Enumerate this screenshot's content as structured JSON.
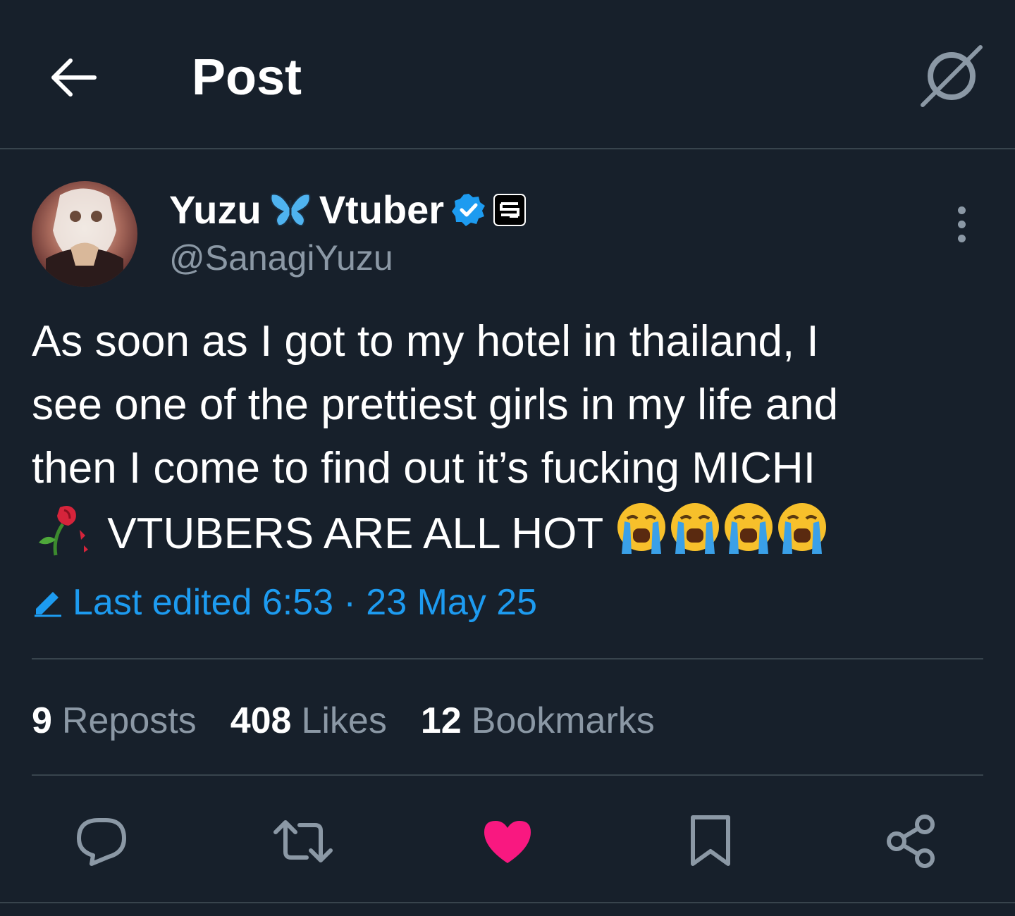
{
  "header": {
    "title": "Post"
  },
  "author": {
    "name_part1": "Yuzu",
    "name_part2": "Vtuber",
    "handle": "@SanagiYuzu",
    "verified_color": "#1d9bf0"
  },
  "post": {
    "lines": [
      "As soon as I got to my hotel in thailand, I",
      "see one of the prettiest girls in my life and",
      "then I come to find out it’s fucking MICHI",
      "VTUBERS ARE ALL HOT"
    ]
  },
  "edited": {
    "label": "Last edited 6:53 · 23 May 25"
  },
  "stats": [
    {
      "num": "9",
      "label": "Reposts"
    },
    {
      "num": "408",
      "label": "Likes"
    },
    {
      "num": "12",
      "label": "Bookmarks"
    }
  ],
  "icons": {
    "back": "back-arrow-icon",
    "grok": "grok-icon",
    "more": "more-options-icon",
    "reply": "reply-icon",
    "repost": "repost-icon",
    "like": "heart-icon",
    "bookmark": "bookmark-icon",
    "share": "share-icon"
  },
  "colors": {
    "background": "#17202b",
    "accent": "#1d9bf0",
    "like": "#f91880",
    "muted": "#8b98a5"
  }
}
